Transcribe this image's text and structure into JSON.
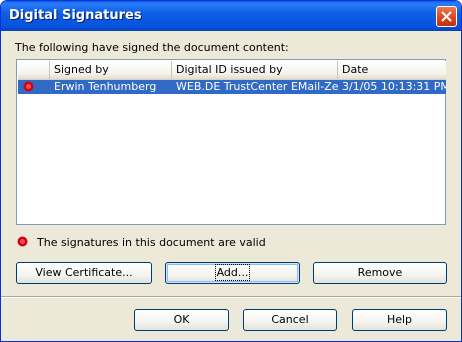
{
  "window": {
    "title": "Digital Signatures"
  },
  "intro_text": "The following have signed the document content:",
  "table": {
    "columns": [
      "",
      "Signed by",
      "Digital ID issued by",
      "Date"
    ],
    "rows": [
      {
        "signed_by": "Erwin Tenhumberg",
        "issued_by": "WEB.DE TrustCenter EMail-Zertif",
        "date": "3/1/05 10:13:31 PM",
        "selected": true
      }
    ]
  },
  "status_text": "The signatures in this document are valid",
  "buttons": {
    "view_certificate": "View Certificate...",
    "add": "Add...",
    "remove": "Remove",
    "ok": "OK",
    "cancel": "Cancel",
    "help": "Help"
  },
  "colors": {
    "titlebar": "#0a5ce8",
    "selection": "#316ac5",
    "seal": "#d0021b",
    "face": "#ece9d8"
  },
  "icons": [
    "close-icon",
    "signature-seal-icon"
  ]
}
